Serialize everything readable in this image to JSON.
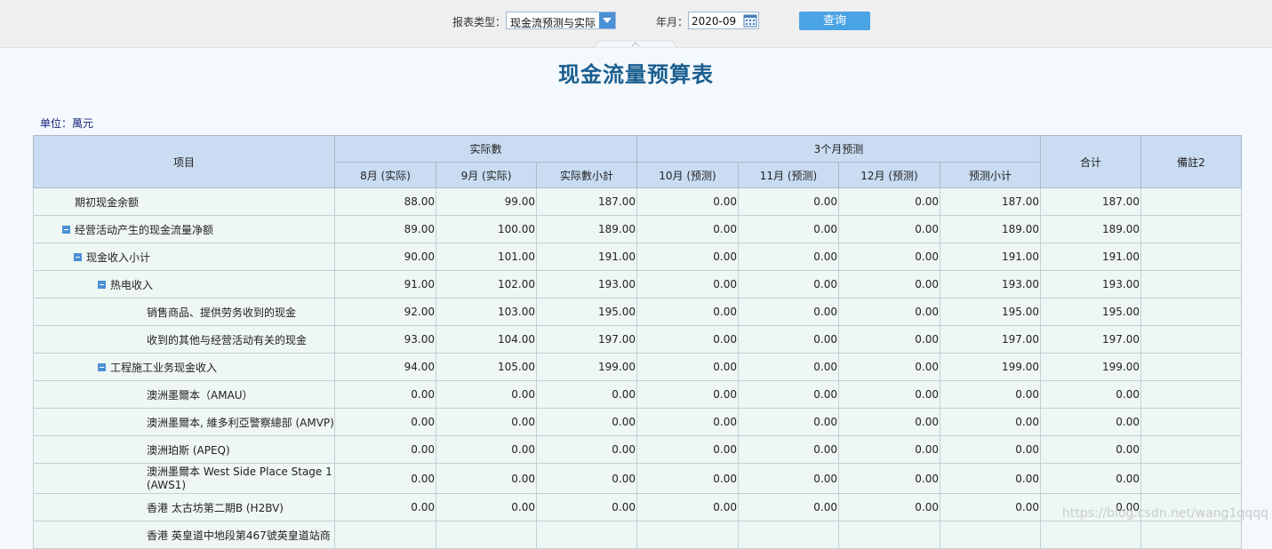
{
  "toolbar": {
    "report_type_label": "报表类型：",
    "report_type_value": "现金流预测与实际",
    "month_label": "年月：",
    "month_value": "2020-09",
    "query_label": "查询"
  },
  "page_title": "现金流量预算表",
  "unit": "单位：萬元",
  "table": {
    "headers": {
      "item": "项目",
      "actual_group": "实际數",
      "forecast_group": "3个月预测",
      "total": "合计",
      "remark": "備註2",
      "sub": [
        "8月 (实际)",
        "9月 (实际)",
        "实际數小計",
        "10月 (预测)",
        "11月 (预测)",
        "12月 (预测)",
        "预测小计"
      ]
    },
    "rows": [
      {
        "name": "期初现金余额",
        "level": 1,
        "toggle": false,
        "values": [
          "88.00",
          "99.00",
          "187.00",
          "0.00",
          "0.00",
          "0.00",
          "187.00",
          "187.00"
        ]
      },
      {
        "name": "经营活动产生的现金流量净额",
        "level": 1,
        "toggle": true,
        "values": [
          "89.00",
          "100.00",
          "189.00",
          "0.00",
          "0.00",
          "0.00",
          "189.00",
          "189.00"
        ]
      },
      {
        "name": "现金收入小计",
        "level": 2,
        "toggle": true,
        "values": [
          "90.00",
          "101.00",
          "191.00",
          "0.00",
          "0.00",
          "0.00",
          "191.00",
          "191.00"
        ]
      },
      {
        "name": "热电收入",
        "level": 3,
        "toggle": true,
        "values": [
          "91.00",
          "102.00",
          "193.00",
          "0.00",
          "0.00",
          "0.00",
          "193.00",
          "193.00"
        ]
      },
      {
        "name": "销售商品、提供劳务收到的现金",
        "level": 4,
        "toggle": false,
        "values": [
          "92.00",
          "103.00",
          "195.00",
          "0.00",
          "0.00",
          "0.00",
          "195.00",
          "195.00"
        ]
      },
      {
        "name": "收到的其他与经营活动有关的现金",
        "level": 4,
        "toggle": false,
        "values": [
          "93.00",
          "104.00",
          "197.00",
          "0.00",
          "0.00",
          "0.00",
          "197.00",
          "197.00"
        ]
      },
      {
        "name": "工程施工业务现金收入",
        "level": 3,
        "toggle": true,
        "values": [
          "94.00",
          "105.00",
          "199.00",
          "0.00",
          "0.00",
          "0.00",
          "199.00",
          "199.00"
        ]
      },
      {
        "name": "澳洲墨爾本（AMAU）",
        "level": 4,
        "toggle": false,
        "values": [
          "0.00",
          "0.00",
          "0.00",
          "0.00",
          "0.00",
          "0.00",
          "0.00",
          "0.00"
        ]
      },
      {
        "name": "澳洲墨爾本, 維多利亞警察總部 (AMVP)",
        "level": 4,
        "toggle": false,
        "values": [
          "0.00",
          "0.00",
          "0.00",
          "0.00",
          "0.00",
          "0.00",
          "0.00",
          "0.00"
        ]
      },
      {
        "name": "澳洲珀斯 (APEQ)",
        "level": 4,
        "toggle": false,
        "values": [
          "0.00",
          "0.00",
          "0.00",
          "0.00",
          "0.00",
          "0.00",
          "0.00",
          "0.00"
        ]
      },
      {
        "name": "澳洲墨爾本 West Side Place Stage 1 (AWS1)",
        "level": 4,
        "toggle": false,
        "wrap": true,
        "values": [
          "0.00",
          "0.00",
          "0.00",
          "0.00",
          "0.00",
          "0.00",
          "0.00",
          "0.00"
        ]
      },
      {
        "name": "香港 太古坊第二期B (H2BV)",
        "level": 4,
        "toggle": false,
        "values": [
          "0.00",
          "0.00",
          "0.00",
          "0.00",
          "0.00",
          "0.00",
          "0.00",
          "0.00"
        ]
      },
      {
        "name": "香港 英皇道中地段第467號英皇道站商",
        "level": 4,
        "toggle": false,
        "values": [
          "",
          "",
          "",
          "",
          "",
          "",
          "",
          ""
        ]
      }
    ]
  },
  "watermark": "https://blog.csdn.net/wang1qqqq",
  "colors": {
    "accent": "#4a90d6",
    "title": "#1b5e8f",
    "header_bg": "#c9dcf2",
    "row_bg": "#eef7f4"
  }
}
